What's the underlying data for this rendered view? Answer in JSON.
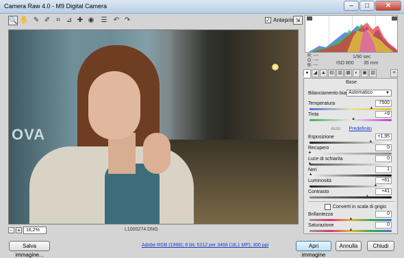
{
  "window": {
    "title": "Camera Raw 4.0  -  M9 Digital Camera",
    "minimize": "–",
    "maximize": "□",
    "close": "✕"
  },
  "toolbar": {
    "tools": [
      "zoom-tool",
      "hand-tool",
      "white-balance-tool",
      "color-sampler-tool",
      "crop-tool",
      "straighten-tool",
      "retouch-tool",
      "red-eye-tool",
      "preferences",
      "rotate-left",
      "rotate-right"
    ],
    "preview_label": "Anteprima",
    "preview_checked": true
  },
  "image": {
    "wall_text": "OVA",
    "filename": "L1000274.DNG"
  },
  "zoom": {
    "minus": "-",
    "plus": "+",
    "value": "16,2%"
  },
  "readout": {
    "r": "R:   ---",
    "g": "G:   ---",
    "b": "B:   ---",
    "shutter": "1/90 sec",
    "iso": "ISO 800",
    "focal": "35 mm"
  },
  "panel": {
    "title": "Base",
    "wb_label": "Bilanciamento bianco:",
    "wb_value": "Automatico",
    "auto_link": "Auto",
    "default_link": "Predefinito",
    "grayscale_label": "Converti in scala di grigio",
    "grayscale_checked": false,
    "sliders": [
      {
        "label": "Temperatura",
        "value": "7500",
        "pos": 0.75
      },
      {
        "label": "Tinta",
        "value": "+9",
        "pos": 0.53
      },
      {
        "label": "Esposizione",
        "value": "+1,95",
        "pos": 0.74
      },
      {
        "label": "Recupero",
        "value": "0",
        "pos": 0.0
      },
      {
        "label": "Luce di schiarita",
        "value": "0",
        "pos": 0.0
      },
      {
        "label": "Neri",
        "value": "1",
        "pos": 0.01
      },
      {
        "label": "Luminosità",
        "value": "+61",
        "pos": 0.8
      },
      {
        "label": "Contrasto",
        "value": "+41",
        "pos": 0.7
      },
      {
        "label": "Brillantezza",
        "value": "0",
        "pos": 0.5
      },
      {
        "label": "Saturazione",
        "value": "0",
        "pos": 0.5
      }
    ]
  },
  "buttons": {
    "save": "Salva immagine...",
    "open": "Apri immagine",
    "cancel": "Annulla",
    "done": "Chiudi"
  },
  "info_link": "Adobe RGB (1998); 8 bit; 5212 per 3468 (18,1 MP); 300 ppi",
  "colors": {
    "accent": "#3c7fb1",
    "link": "#1a3cc8"
  }
}
